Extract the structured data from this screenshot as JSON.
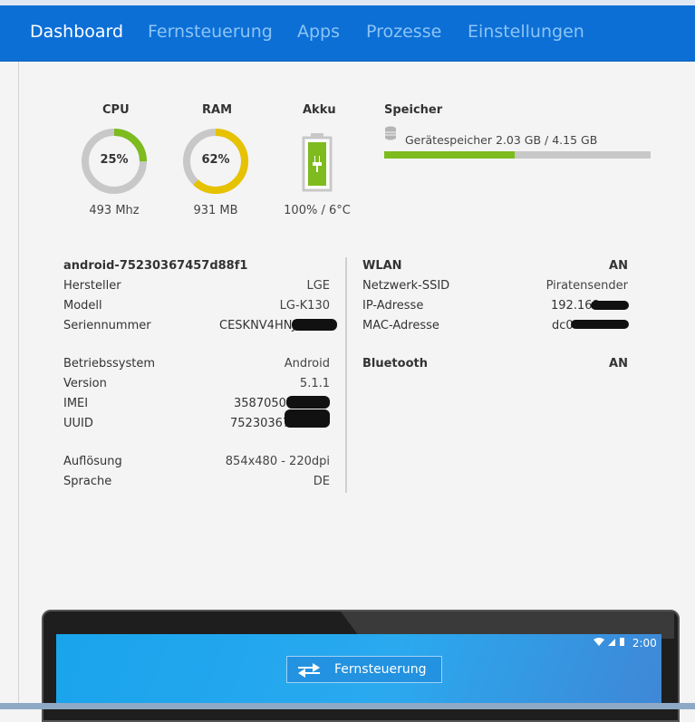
{
  "nav": {
    "items": [
      "Dashboard",
      "Fernsteuerung",
      "Apps",
      "Prozesse",
      "Einstellungen"
    ],
    "active": "Dashboard"
  },
  "gauges": {
    "cpu": {
      "title": "CPU",
      "percent_label": "25%",
      "percent": 25,
      "sub": "493 Mhz",
      "color": "#7dbb1e"
    },
    "ram": {
      "title": "RAM",
      "percent_label": "62%",
      "percent": 62,
      "sub": "931 MB",
      "color": "#e6c200"
    },
    "akku": {
      "title": "Akku",
      "sub": "100% / 6°C",
      "level": 100,
      "color": "#7dbb1e"
    }
  },
  "storage": {
    "title": "Speicher",
    "text": "Gerätespeicher 2.03 GB / 4.15 GB",
    "fraction": 0.489
  },
  "device": {
    "name": "android-75230367457d88f1",
    "rows": [
      {
        "label": "Hersteller",
        "value": "LGE"
      },
      {
        "label": "Modell",
        "value": "LG-K130"
      },
      {
        "label": "Seriennummer",
        "value": "CESKNV4HNJ"
      }
    ],
    "rows2": [
      {
        "label": "Betriebssystem",
        "value": "Android"
      },
      {
        "label": "Version",
        "value": "5.1.1"
      },
      {
        "label": "IMEI",
        "value": "358705071"
      },
      {
        "label": "UUID",
        "value": "752303674"
      }
    ],
    "rows3": [
      {
        "label": "Auflösung",
        "value": "854x480 - 220dpi"
      },
      {
        "label": "Sprache",
        "value": "DE"
      }
    ]
  },
  "network": {
    "wlan_label": "WLAN",
    "wlan_value": "AN",
    "rows": [
      {
        "label": "Netzwerk-SSID",
        "value": "Piratensender"
      },
      {
        "label": "IP-Adresse",
        "value": "192.168."
      },
      {
        "label": "MAC-Adresse",
        "value": "dc0"
      }
    ],
    "bt_label": "Bluetooth",
    "bt_value": "AN"
  },
  "preview": {
    "time": "2:00",
    "button_label": "Fernsteuerung"
  }
}
